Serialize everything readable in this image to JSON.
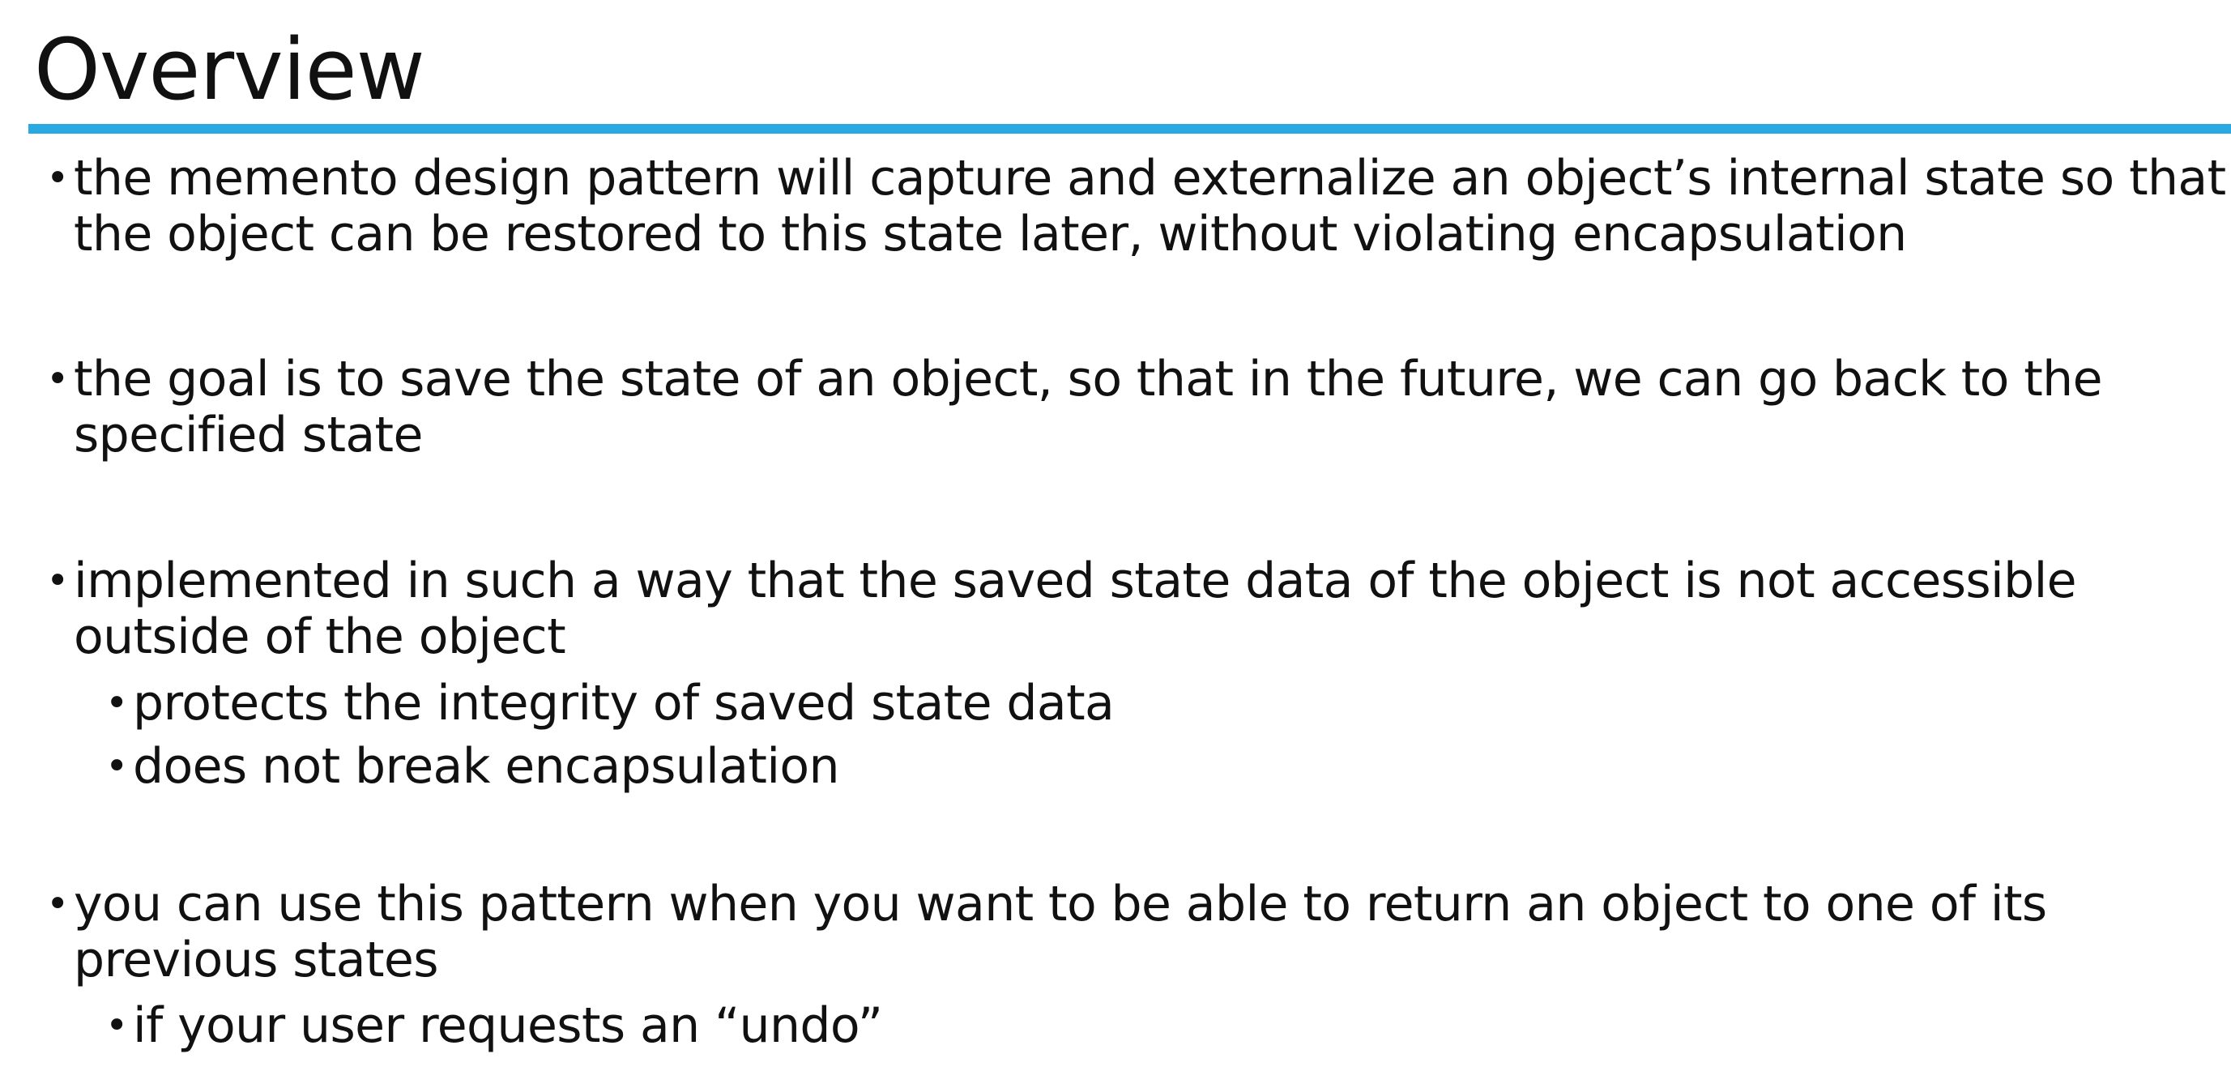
{
  "slide": {
    "title": "Overview",
    "accent_color": "#29a9e1",
    "bullets": [
      {
        "line1": "the memento design pattern will capture and externalize an object’s internal state so that",
        "line2": "the object can be restored to this state later, without violating encapsulation"
      },
      {
        "line1": "the goal is to save the state of an object, so that in the future, we can go back to the",
        "line2": "specified state"
      },
      {
        "line1": "implemented in such a way that the saved state data of the object is not accessible",
        "line2": "outside of the object",
        "sub": [
          "protects the integrity of saved state data",
          "does not break encapsulation"
        ]
      },
      {
        "line1": "you can use this pattern when you want to be able to return an object to one of its",
        "line2": "previous states",
        "sub": [
          "if your user requests an “undo”"
        ]
      }
    ],
    "bullet_glyph": "•"
  }
}
